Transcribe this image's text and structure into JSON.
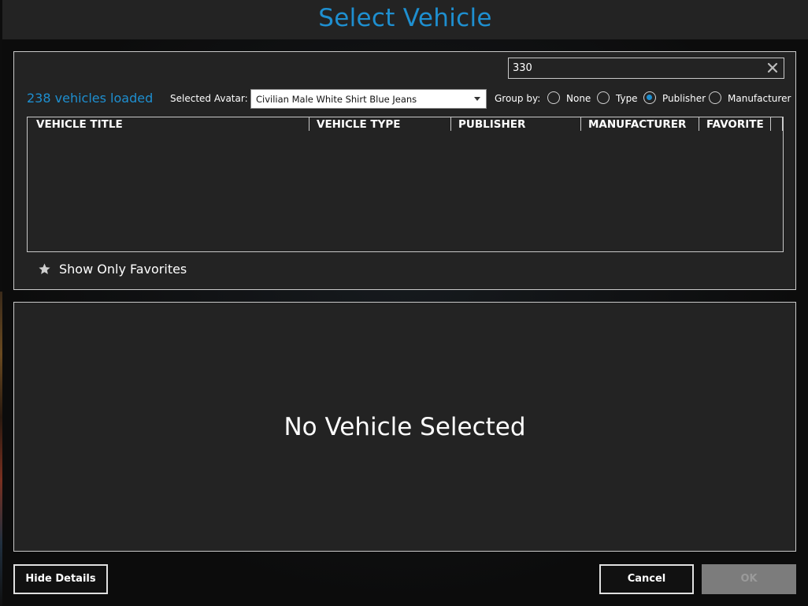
{
  "window": {
    "title": "Select Vehicle"
  },
  "search": {
    "value": "330",
    "clear_icon": "close-icon"
  },
  "vehicle_count": "238 vehicles loaded",
  "avatar": {
    "label": "Selected Avatar:",
    "value": "Civilian Male White Shirt Blue Jeans"
  },
  "group_by": {
    "label": "Group by:",
    "options": [
      {
        "label": "None",
        "checked": false
      },
      {
        "label": "Type",
        "checked": false
      },
      {
        "label": "Publisher",
        "checked": true
      },
      {
        "label": "Manufacturer",
        "checked": false
      }
    ]
  },
  "table": {
    "columns": [
      "VEHICLE TITLE",
      "VEHICLE TYPE",
      "PUBLISHER",
      "MANUFACTURER",
      "FAVORITE"
    ],
    "rows": []
  },
  "favorites_toggle": {
    "label": "Show Only Favorites",
    "icon": "star-icon"
  },
  "details": {
    "empty_message": "No Vehicle Selected"
  },
  "buttons": {
    "hide_details": "Hide Details",
    "cancel": "Cancel",
    "ok": "OK"
  },
  "colors": {
    "accent": "#1e8fd0",
    "panel": "#232323",
    "border": "#c9c9c9",
    "disabled": "#7c7c7c"
  }
}
